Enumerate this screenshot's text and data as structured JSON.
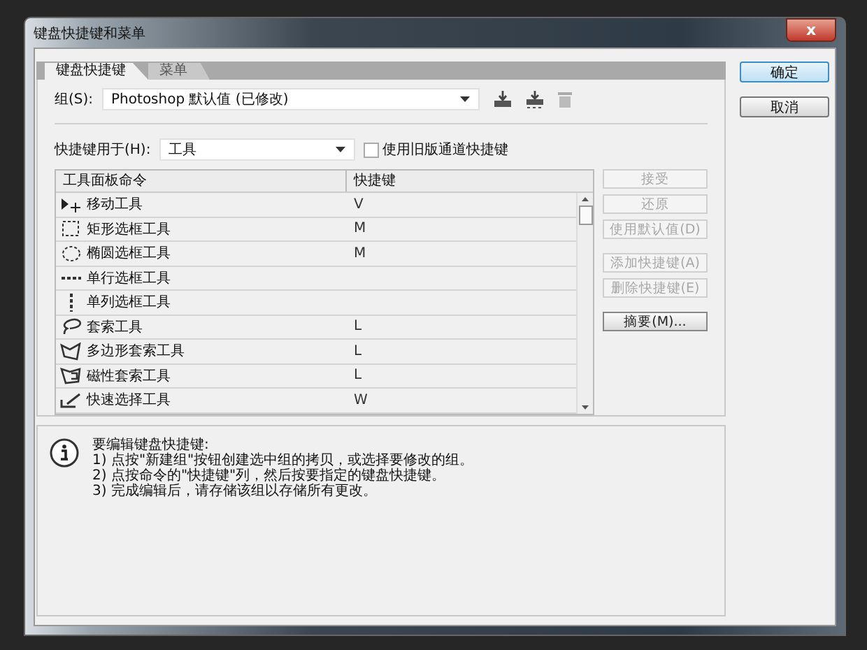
{
  "window": {
    "title": "键盘快捷键和菜单",
    "close": "x"
  },
  "tabs": [
    {
      "label": "键盘快捷键",
      "selected": true
    },
    {
      "label": "菜单",
      "selected": false
    }
  ],
  "group": {
    "label": "组(S):",
    "value": "Photoshop 默认值 (已修改)"
  },
  "shortcuts_for": {
    "label": "快捷键用于(H):",
    "value": "工具",
    "legacy_checkbox": {
      "label": "使用旧版通道快捷键",
      "checked": false
    }
  },
  "table": {
    "columns": [
      "工具面板命令",
      "快捷键"
    ],
    "rows": [
      {
        "name": "移动工具",
        "shortcut": "V"
      },
      {
        "name": "矩形选框工具",
        "shortcut": "M"
      },
      {
        "name": "椭圆选框工具",
        "shortcut": "M"
      },
      {
        "name": "单行选框工具",
        "shortcut": ""
      },
      {
        "name": "单列选框工具",
        "shortcut": ""
      },
      {
        "name": "套索工具",
        "shortcut": "L"
      },
      {
        "name": "多边形套索工具",
        "shortcut": "L"
      },
      {
        "name": "磁性套索工具",
        "shortcut": "L"
      },
      {
        "name": "快速选择工具",
        "shortcut": "W"
      }
    ]
  },
  "side_buttons": [
    {
      "label": "接受",
      "disabled": true
    },
    {
      "label": "还原",
      "disabled": true
    },
    {
      "label": "使用默认值(D)",
      "disabled": true
    },
    {
      "label": "添加快捷键(A)",
      "disabled": true
    },
    {
      "label": "删除快捷键(E)",
      "disabled": true
    },
    {
      "label": "摘要(M)...",
      "disabled": false
    }
  ],
  "info": {
    "lines": [
      "要编辑键盘快捷键:",
      "1) 点按\"新建组\"按钮创建选中组的拷贝，或选择要修改的组。",
      "2) 点按命令的\"快捷键\"列，然后按要指定的键盘快捷键。",
      "3) 完成编辑后，请存储该组以存储所有更改。"
    ]
  },
  "dialog_buttons": [
    {
      "label": "确定",
      "default": true
    },
    {
      "label": "取消",
      "default": false
    }
  ]
}
